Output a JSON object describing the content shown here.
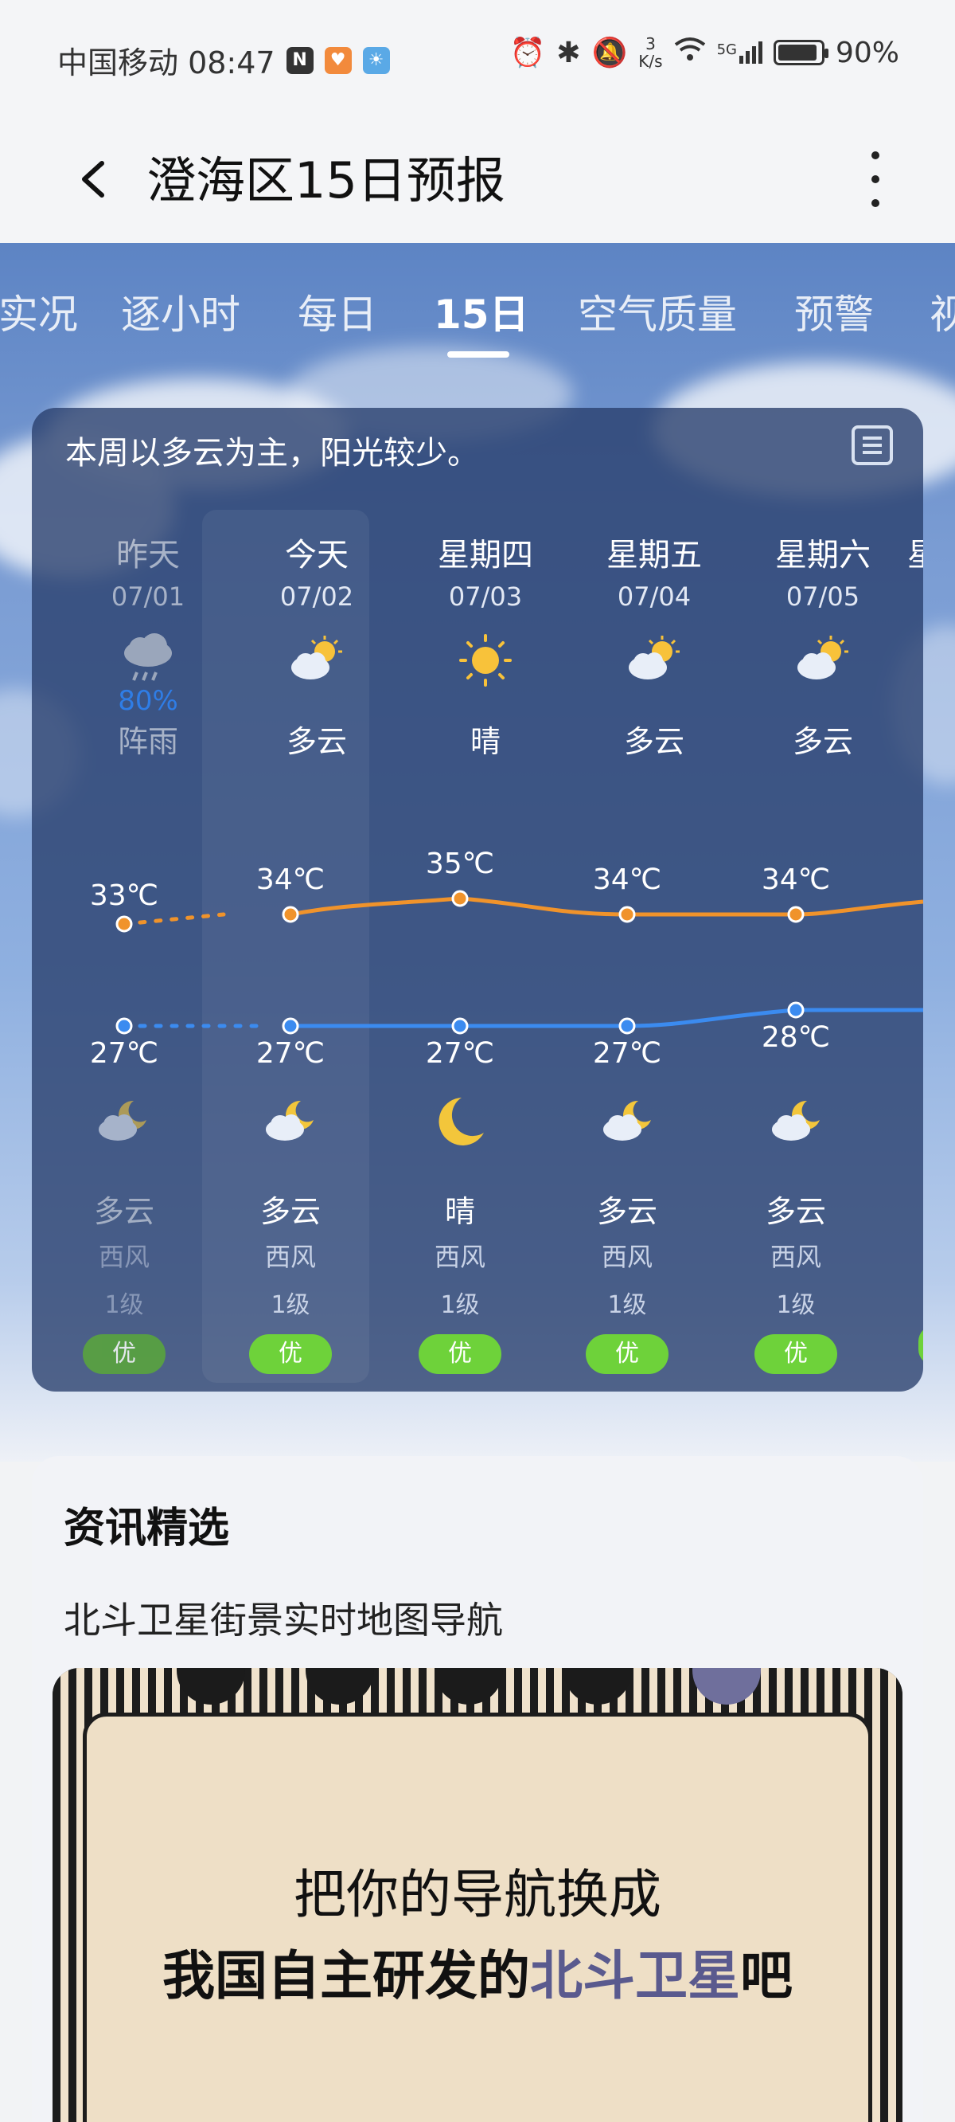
{
  "status_bar": {
    "carrier_time": "中国移动 08:47",
    "net_speed_value": "3",
    "net_speed_unit": "K/s",
    "signal": "5G",
    "battery": "90%"
  },
  "header": {
    "title": "澄海区15日预报"
  },
  "tabs": [
    {
      "label": "实况"
    },
    {
      "label": "逐小时"
    },
    {
      "label": "每日"
    },
    {
      "label": "15日"
    },
    {
      "label": "空气质量"
    },
    {
      "label": "预警"
    },
    {
      "label": "视"
    }
  ],
  "forecast": {
    "summary": "本周以多云为主，阳光较少。",
    "days": [
      {
        "day": "昨天",
        "date": "07/01",
        "icon": "cloud-rain-icon",
        "precip": "80%",
        "day_cond": "阵雨",
        "high": "33℃",
        "low": "27℃",
        "night_icon": "cloud-moon-icon",
        "night_cond": "多云",
        "wind": "西风",
        "level": "1级",
        "aq": "优",
        "past": true
      },
      {
        "day": "今天",
        "date": "07/02",
        "icon": "partly-cloudy-icon",
        "precip": "",
        "day_cond": "多云",
        "high": "34℃",
        "low": "27℃",
        "night_icon": "cloud-moon-icon",
        "night_cond": "多云",
        "wind": "西风",
        "level": "1级",
        "aq": "优"
      },
      {
        "day": "星期四",
        "date": "07/03",
        "icon": "sun-icon",
        "precip": "",
        "day_cond": "晴",
        "high": "35℃",
        "low": "27℃",
        "night_icon": "moon-icon",
        "night_cond": "晴",
        "wind": "西风",
        "level": "1级",
        "aq": "优"
      },
      {
        "day": "星期五",
        "date": "07/04",
        "icon": "partly-cloudy-icon",
        "precip": "",
        "day_cond": "多云",
        "high": "34℃",
        "low": "27℃",
        "night_icon": "cloud-moon-icon",
        "night_cond": "多云",
        "wind": "西风",
        "level": "1级",
        "aq": "优"
      },
      {
        "day": "星期六",
        "date": "07/05",
        "icon": "partly-cloudy-icon",
        "precip": "",
        "day_cond": "多云",
        "high": "34℃",
        "low": "28℃",
        "night_icon": "cloud-moon-icon",
        "night_cond": "多云",
        "wind": "西风",
        "level": "1级",
        "aq": "优"
      }
    ],
    "partial_next_day": "星",
    "colors": {
      "high_line": "#f0932b",
      "low_line": "#3b8bf0",
      "aq_good": "#6ed23a"
    }
  },
  "news": {
    "heading": "资讯精选",
    "item_title": "北斗卫星街景实时地图导航",
    "ad_line1": "把你的导航换成",
    "ad_line2_prefix": "我国自主研发的",
    "ad_line2_highlight": "北斗卫星",
    "ad_line2_suffix": "吧"
  }
}
